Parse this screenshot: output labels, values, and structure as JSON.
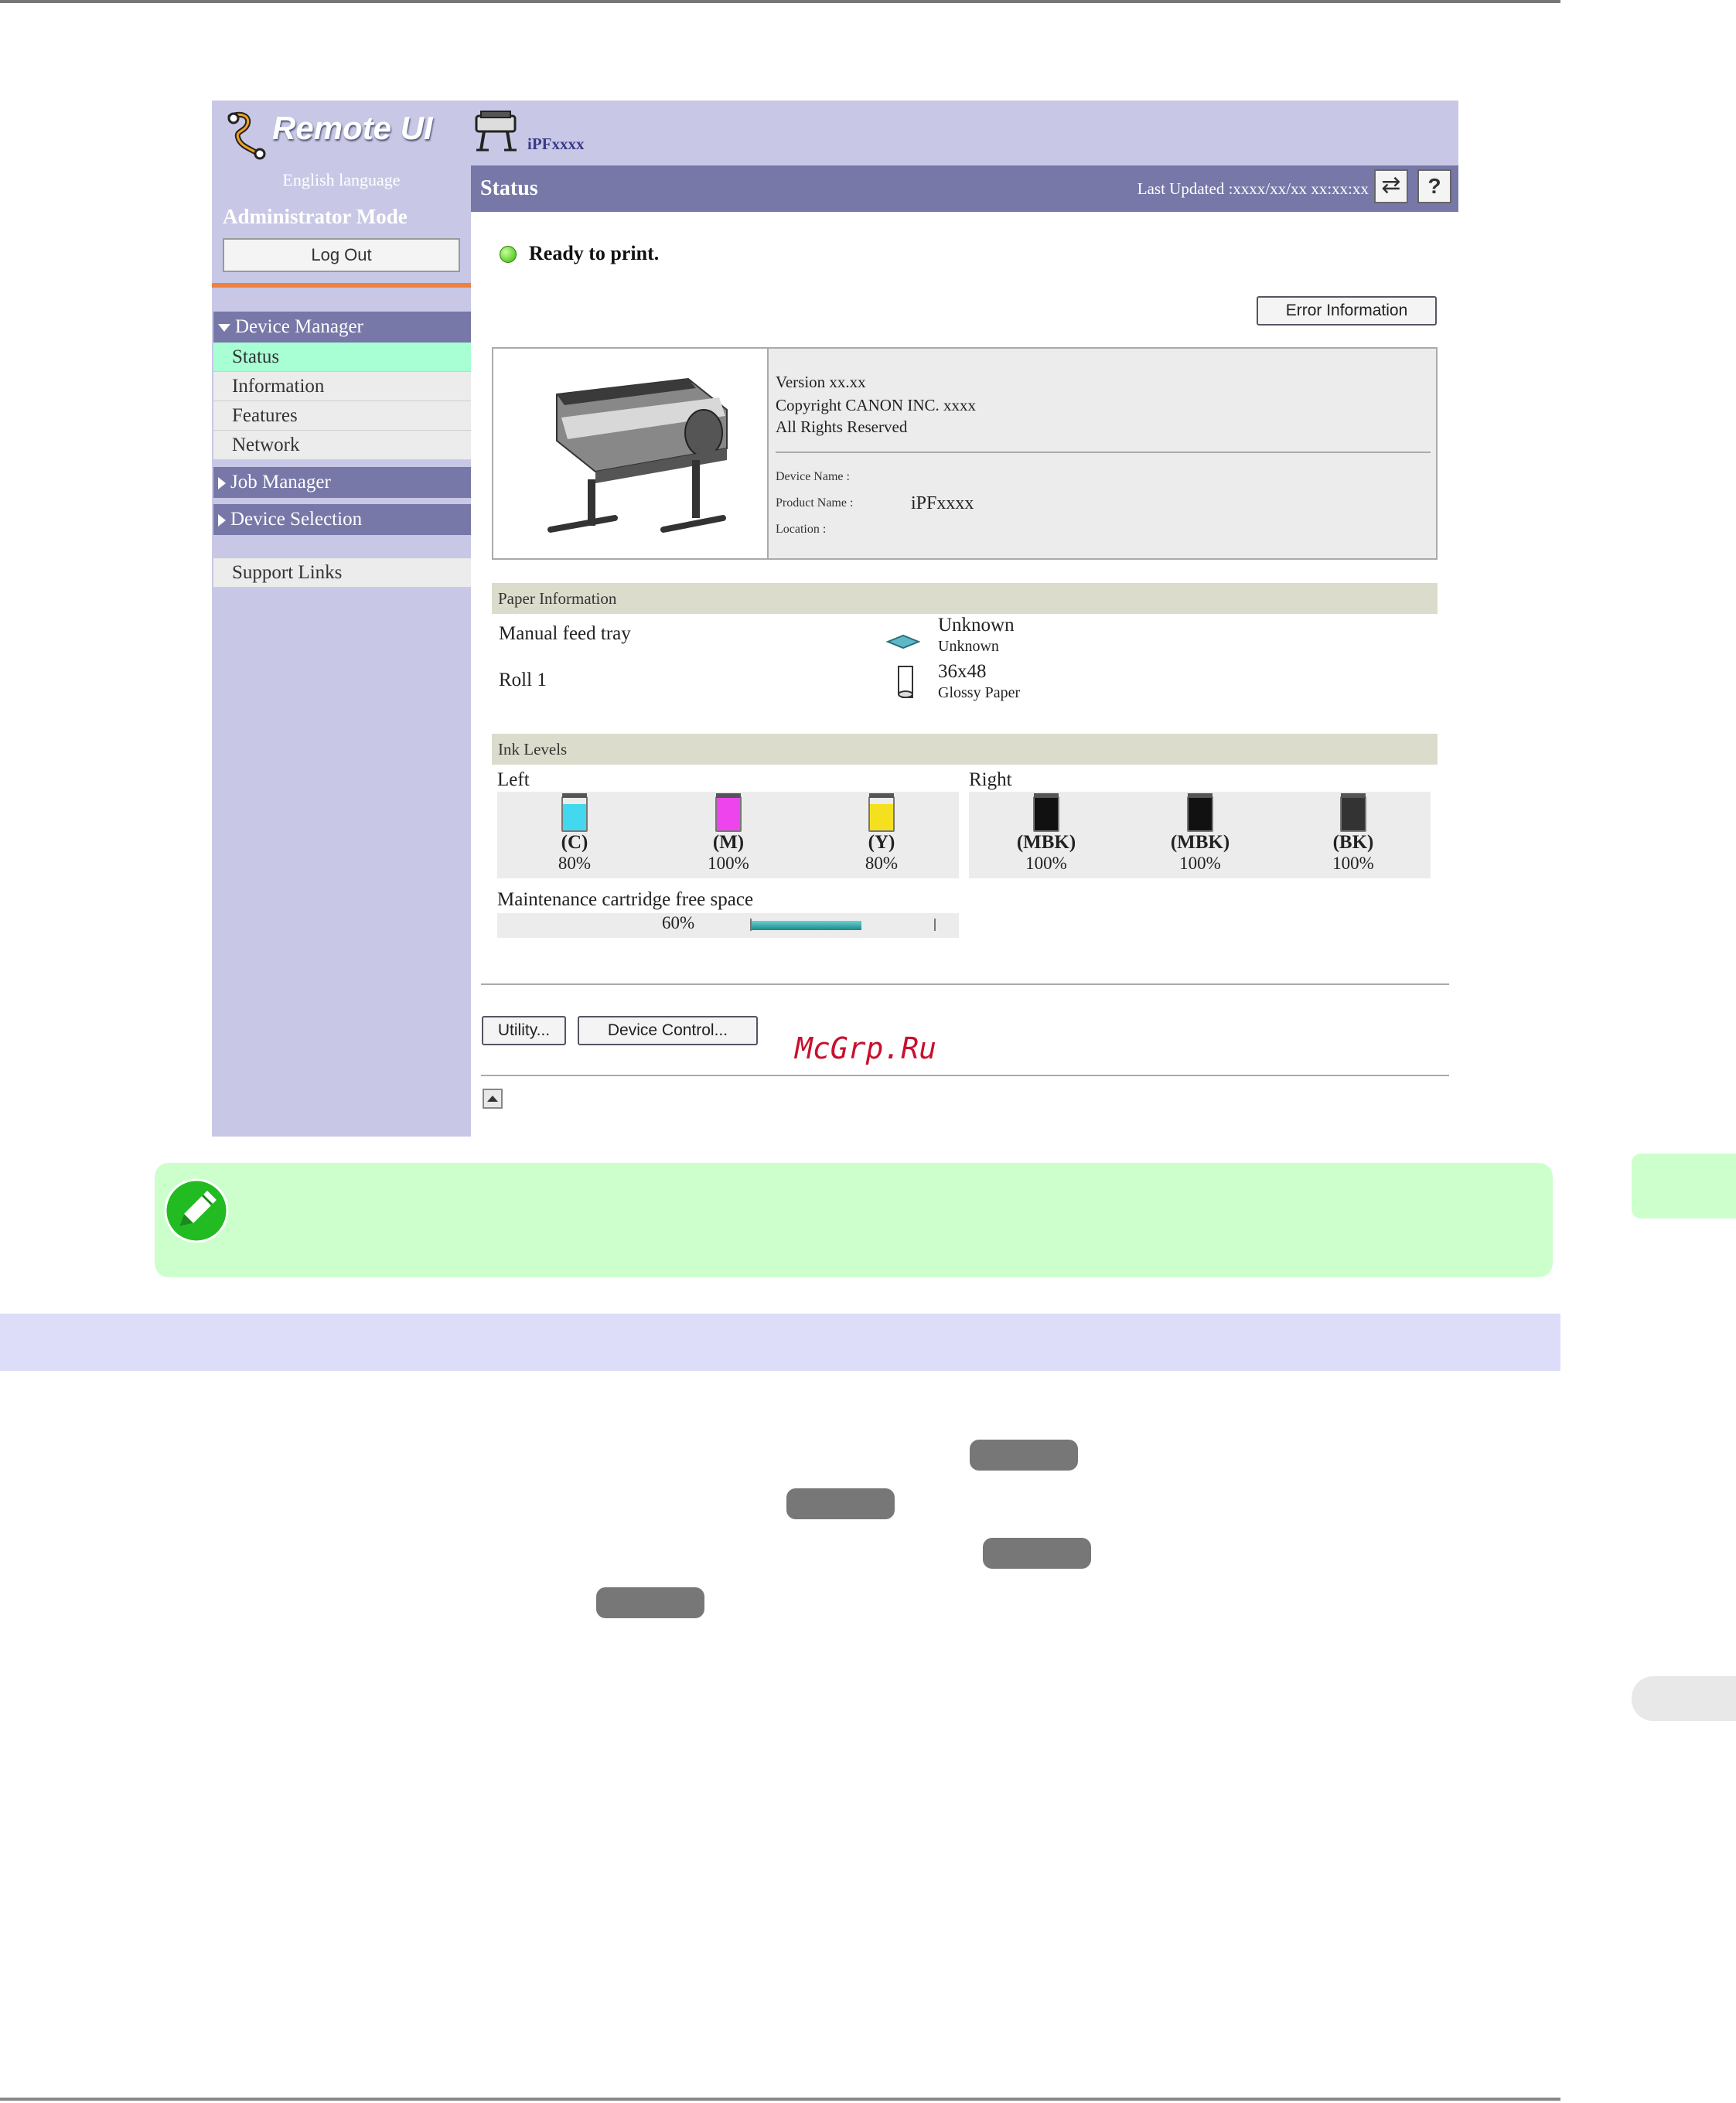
{
  "sidebar": {
    "logo_text": "Remote UI",
    "language_link": "English language",
    "admin_mode": "Administrator Mode",
    "logout_label": "Log Out",
    "device_manager": "Device Manager",
    "device_manager_items": [
      "Status",
      "Information",
      "Features",
      "Network"
    ],
    "job_manager": "Job Manager",
    "device_selection": "Device Selection",
    "support_links": "Support Links"
  },
  "header": {
    "device_name": "iPFxxxx",
    "page_title": "Status",
    "last_updated": "Last Updated :xxxx/xx/xx xx:xx:xx",
    "refresh_icon": "refresh-icon",
    "help_label": "?"
  },
  "status": {
    "message": "Ready to print.",
    "indicator_color": "#33bb00",
    "error_button": "Error Information"
  },
  "device_info": {
    "version": "Version xx.xx",
    "copyright": "Copyright CANON INC. xxxx",
    "rights": "All Rights Reserved",
    "device_name_label": "Device Name :",
    "product_name_label": "Product Name :",
    "product_name_value": "iPFxxxx",
    "location_label": "Location :"
  },
  "paper": {
    "section_title": "Paper Information",
    "rows": [
      {
        "source": "Manual feed tray",
        "size": "Unknown",
        "type": "Unknown",
        "icon": "tray-icon"
      },
      {
        "source": "Roll 1",
        "size": "36x48",
        "type": "Glossy Paper",
        "icon": "roll-icon"
      }
    ]
  },
  "ink": {
    "section_title": "Ink Levels",
    "left_label": "Left",
    "right_label": "Right",
    "left": [
      {
        "name": "(C)",
        "percent": "80%",
        "level": 80,
        "color": "#44d8ee"
      },
      {
        "name": "(M)",
        "percent": "100%",
        "level": 100,
        "color": "#ee44ee"
      },
      {
        "name": "(Y)",
        "percent": "80%",
        "level": 80,
        "color": "#f5e020"
      }
    ],
    "right": [
      {
        "name": "(MBK)",
        "percent": "100%",
        "level": 100,
        "color": "#111111"
      },
      {
        "name": "(MBK)",
        "percent": "100%",
        "level": 100,
        "color": "#111111"
      },
      {
        "name": "(BK)",
        "percent": "100%",
        "level": 100,
        "color": "#333333"
      }
    ],
    "maintenance_label": "Maintenance cartridge free space",
    "maintenance_percent": "60%",
    "maintenance_level": 60
  },
  "actions": {
    "utility": "Utility...",
    "device_control": "Device Control..."
  },
  "watermark": "McGrp.Ru",
  "colors": {
    "nav_header": "#7777a8",
    "panel_bg": "#c8c8e6",
    "active_item": "#a8ffd4",
    "note_bg": "#ccffcc"
  }
}
